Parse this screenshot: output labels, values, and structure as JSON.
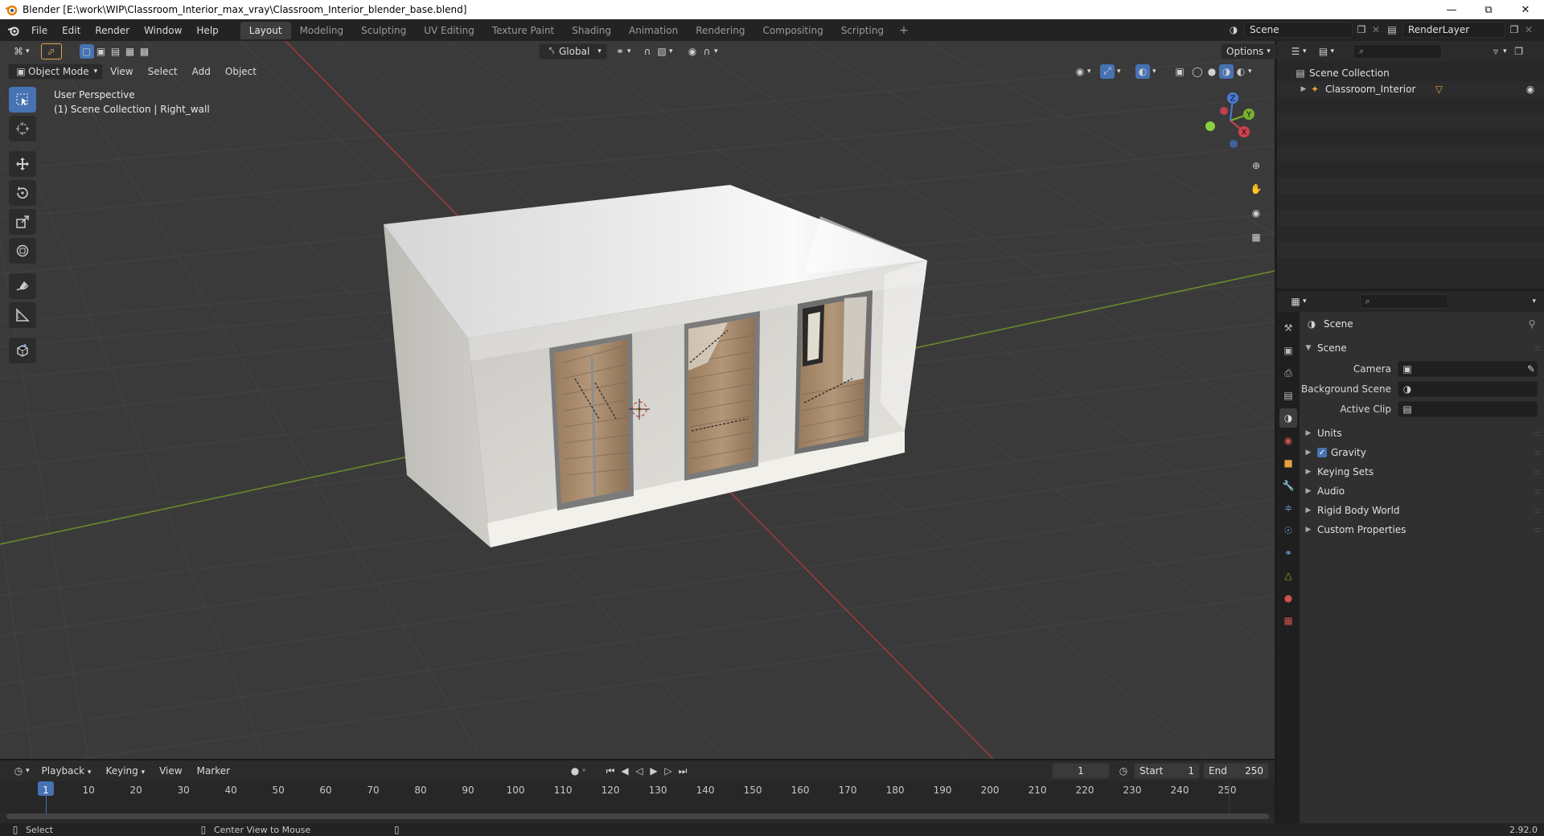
{
  "window": {
    "title": "Blender [E:\\work\\WIP\\Classroom_Interior_max_vray\\Classroom_Interior_blender_base.blend]",
    "controls": [
      "minimize-icon",
      "restore-icon",
      "close-icon"
    ]
  },
  "menu": [
    "File",
    "Edit",
    "Render",
    "Window",
    "Help"
  ],
  "workspaces": {
    "tabs": [
      "Layout",
      "Modeling",
      "Sculpting",
      "UV Editing",
      "Texture Paint",
      "Shading",
      "Animation",
      "Rendering",
      "Compositing",
      "Scripting"
    ],
    "active": "Layout"
  },
  "scene_selector": {
    "value": "Scene"
  },
  "view_layer_selector": {
    "value": "RenderLayer"
  },
  "viewport": {
    "mode": "Object Mode",
    "menus": [
      "View",
      "Select",
      "Add",
      "Object"
    ],
    "transform_orientation": "Global",
    "options_label": "Options",
    "overlay_line1": "User Perspective",
    "overlay_line2": "(1) Scene Collection | Right_wall",
    "gizmo_axes": [
      "X",
      "Y",
      "Z"
    ],
    "colors": {
      "background": "#3a3a3a",
      "grid": "#474747",
      "x_axis": "#9b3a3a",
      "y_axis": "#6a8a2a",
      "wall": "#d9d7d2",
      "floor_wood": "#a6896a"
    }
  },
  "timeline": {
    "menus": [
      "Playback",
      "Keying",
      "View",
      "Marker"
    ],
    "current_frame": "1",
    "start_label": "Start",
    "start_value": "1",
    "end_label": "End",
    "end_value": "250",
    "ticks": [
      "1",
      "10",
      "20",
      "30",
      "40",
      "50",
      "60",
      "70",
      "80",
      "90",
      "100",
      "110",
      "120",
      "130",
      "140",
      "150",
      "160",
      "170",
      "180",
      "190",
      "200",
      "210",
      "220",
      "230",
      "240",
      "250"
    ]
  },
  "statusbar": {
    "left_action": "Select",
    "middle_action": "Center View to Mouse",
    "version": "2.92.0"
  },
  "outliner": {
    "root": "Scene Collection",
    "items": [
      {
        "label": "Classroom_Interior"
      }
    ]
  },
  "properties": {
    "context_title": "Scene",
    "panel_title": "Scene",
    "fields": [
      {
        "label": "Camera",
        "value": ""
      },
      {
        "label": "Background Scene",
        "value": ""
      },
      {
        "label": "Active Clip",
        "value": ""
      }
    ],
    "subpanels": [
      {
        "label": "Units",
        "checkbox": false
      },
      {
        "label": "Gravity",
        "checkbox": true
      },
      {
        "label": "Keying Sets",
        "checkbox": false
      },
      {
        "label": "Audio",
        "checkbox": false
      },
      {
        "label": "Rigid Body World",
        "checkbox": false
      },
      {
        "label": "Custom Properties",
        "checkbox": false
      }
    ]
  }
}
